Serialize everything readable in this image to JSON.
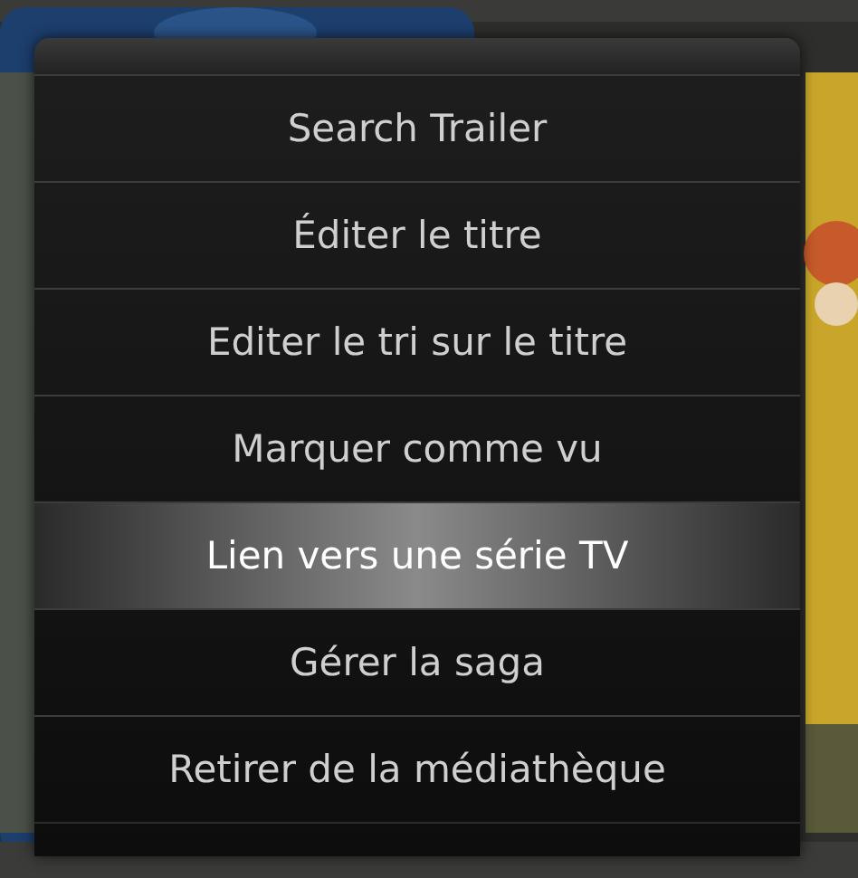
{
  "menu": {
    "items": [
      {
        "label": "Search Trailer",
        "selected": false
      },
      {
        "label": "Éditer le titre",
        "selected": false
      },
      {
        "label": "Editer le tri sur le titre",
        "selected": false
      },
      {
        "label": "Marquer comme vu",
        "selected": false
      },
      {
        "label": "Lien vers une série TV",
        "selected": true
      },
      {
        "label": "Gérer la saga",
        "selected": false
      },
      {
        "label": "Retirer de la médiathèque",
        "selected": false
      }
    ]
  }
}
